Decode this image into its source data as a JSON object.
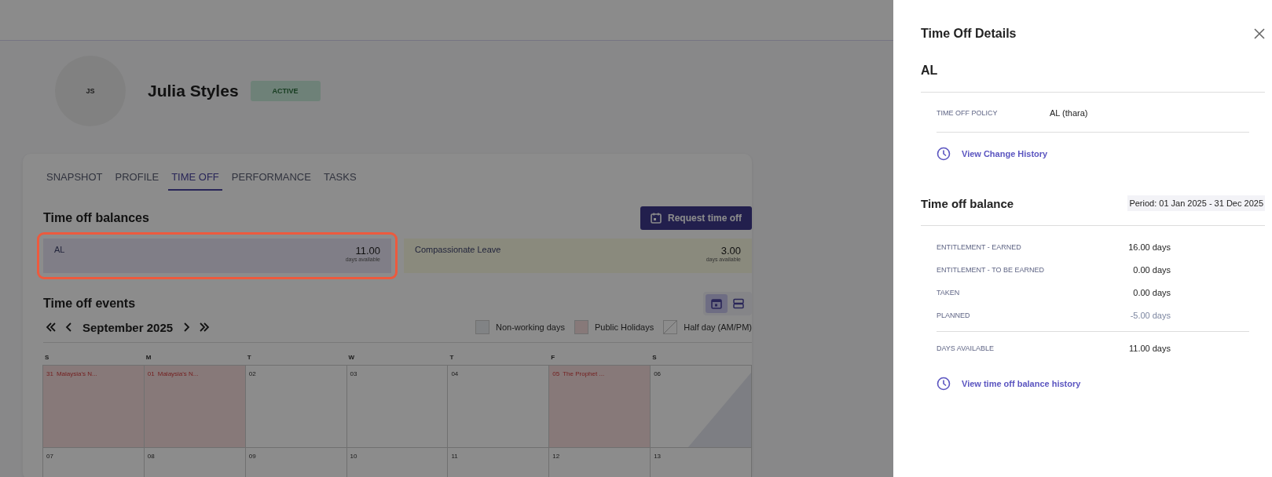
{
  "profile": {
    "initials": "JS",
    "name": "Julia Styles",
    "status": "ACTIVE"
  },
  "tabs": [
    {
      "label": "SNAPSHOT",
      "selected": false
    },
    {
      "label": "PROFILE",
      "selected": false
    },
    {
      "label": "TIME OFF",
      "selected": true
    },
    {
      "label": "PERFORMANCE",
      "selected": false
    },
    {
      "label": "TASKS",
      "selected": false
    }
  ],
  "balances": {
    "title": "Time off balances",
    "button": "Request time off",
    "items": [
      {
        "name": "AL",
        "value": "11.00",
        "unit": "days available",
        "color": "#807e87",
        "selected": true
      },
      {
        "name": "Compassionate Leave",
        "value": "3.00",
        "unit": "days available",
        "color": "#8a8a7d",
        "selected": false
      }
    ]
  },
  "events": {
    "title": "Time off events",
    "views": [
      {
        "kind": "calendar",
        "selected": true
      },
      {
        "kind": "list",
        "selected": false
      }
    ],
    "month": "September 2025",
    "legend": [
      {
        "kind": "nonworking",
        "label": "Non-working days"
      },
      {
        "kind": "holiday",
        "label": "Public Holidays"
      },
      {
        "kind": "halfday",
        "label": "Half day (AM/PM)"
      }
    ],
    "weekdays": [
      "S",
      "M",
      "T",
      "W",
      "T",
      "F",
      "S"
    ],
    "weeks": [
      [
        {
          "day": "31",
          "kind": "holiday",
          "event": "Malaysia's N..."
        },
        {
          "day": "01",
          "kind": "holiday",
          "event": "Malaysia's N..."
        },
        {
          "day": "02",
          "kind": "normal"
        },
        {
          "day": "03",
          "kind": "normal"
        },
        {
          "day": "04",
          "kind": "normal"
        },
        {
          "day": "05",
          "kind": "holiday",
          "event": "The Prophet ..."
        },
        {
          "day": "06",
          "kind": "halfday"
        }
      ],
      [
        {
          "day": "07",
          "kind": "normal"
        },
        {
          "day": "08",
          "kind": "normal"
        },
        {
          "day": "09",
          "kind": "normal"
        },
        {
          "day": "10",
          "kind": "normal"
        },
        {
          "day": "11",
          "kind": "normal"
        },
        {
          "day": "12",
          "kind": "normal"
        },
        {
          "day": "13",
          "kind": "normal"
        }
      ]
    ]
  },
  "panel": {
    "title": "Time Off Details",
    "policy_name": "AL",
    "policy": {
      "label": "TIME OFF POLICY",
      "value": "AL (thara)"
    },
    "change_link": "View Change History",
    "balance_title": "Time off balance",
    "period": "Period: 01 Jan 2025 - 31 Dec 2025",
    "rows": [
      {
        "label": "ENTITLEMENT - EARNED",
        "value": "16.00 days",
        "kind": "normal"
      },
      {
        "label": "ENTITLEMENT - TO BE EARNED",
        "value": "0.00 days",
        "kind": "normal"
      },
      {
        "label": "TAKEN",
        "value": "0.00 days",
        "kind": "normal"
      },
      {
        "label": "PLANNED",
        "value": "-5.00 days",
        "kind": "muted"
      }
    ],
    "total": {
      "label": "DAYS AVAILABLE",
      "value": "11.00 days"
    },
    "history_link": "View time off balance history"
  }
}
